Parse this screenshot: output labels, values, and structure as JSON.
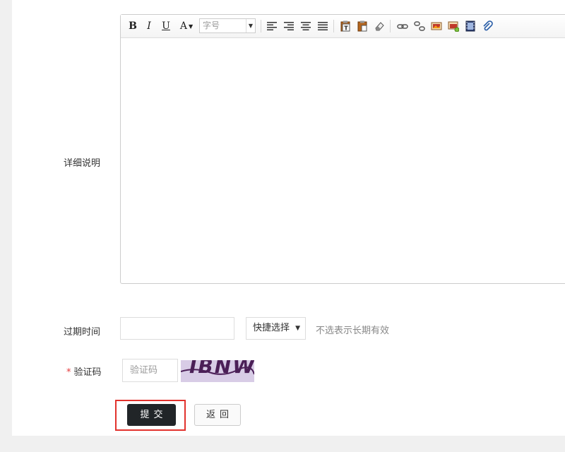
{
  "form": {
    "detail_label": "详细说明",
    "expiry_label": "过期时间",
    "captcha_required_mark": "*",
    "captcha_label": "验证码"
  },
  "editor": {
    "toolbar": {
      "bold": "B",
      "italic": "I",
      "underline": "U",
      "font_color": "A",
      "font_size_placeholder": "字号"
    }
  },
  "expiry": {
    "date_value": "",
    "quick_select_label": "快捷选择",
    "hint": "不选表示长期有效"
  },
  "captcha": {
    "placeholder": "验证码",
    "image_text": "IBNW"
  },
  "buttons": {
    "submit": "提交",
    "back": "返回"
  },
  "colors": {
    "submit_bg": "#212528",
    "highlight_border": "#e2322d",
    "required_mark": "#e4393c",
    "page_bg": "#f0f0f0"
  }
}
